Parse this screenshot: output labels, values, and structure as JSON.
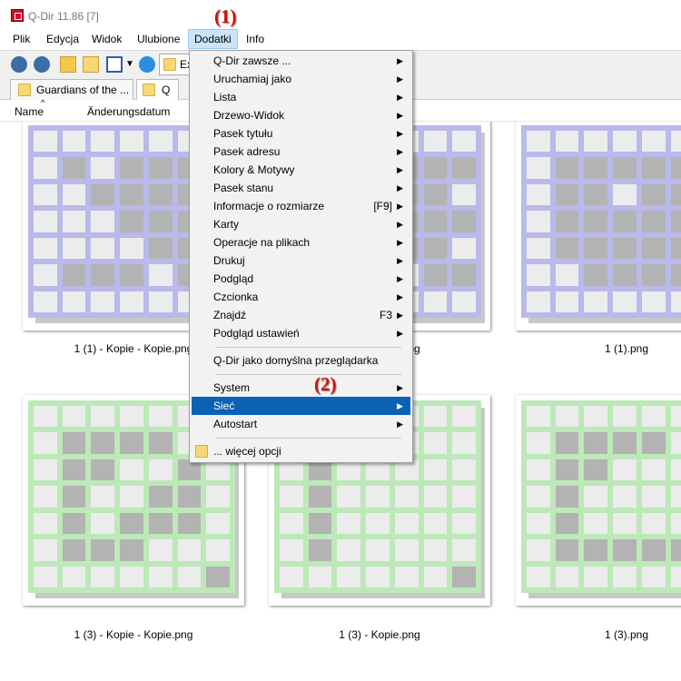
{
  "window": {
    "title": "Q-Dir 11.86 [7]"
  },
  "annotations": {
    "a1": "(1)",
    "a2": "(2)"
  },
  "menubar": {
    "items": [
      "Plik",
      "Edycja",
      "Widok",
      "Ulubione",
      "Dodatki",
      "Info"
    ],
    "active": "Dodatki"
  },
  "toolbar": {
    "address_text": "Ex"
  },
  "tabs": [
    {
      "label": "Guardians of the ..."
    },
    {
      "label": "Q"
    }
  ],
  "columns": {
    "name": "Name",
    "date": "Änderungsdatum"
  },
  "files": {
    "row1": [
      "1 (1) - Kopie - Kopie.png",
      "1 (1) - Kopie.png",
      "1 (1).png"
    ],
    "row2": [
      "1 (3) - Kopie - Kopie.png",
      "1 (3) - Kopie.png",
      "1 (3).png"
    ]
  },
  "dropdown": {
    "items": [
      {
        "label": "Q-Dir zawsze ...",
        "submenu": true
      },
      {
        "label": "Uruchamiaj jako",
        "submenu": true
      },
      {
        "label": "Lista",
        "submenu": true
      },
      {
        "label": "Drzewo-Widok",
        "submenu": true
      },
      {
        "label": "Pasek tytułu",
        "submenu": true
      },
      {
        "label": "Pasek adresu",
        "submenu": true
      },
      {
        "label": "Kolory & Motywy",
        "submenu": true
      },
      {
        "label": "Pasek stanu",
        "submenu": true
      },
      {
        "label": "Informacje o rozmiarze",
        "shortcut": "[F9]",
        "submenu": true
      },
      {
        "label": "Karty",
        "submenu": true
      },
      {
        "label": "Operacje na plikach",
        "submenu": true
      },
      {
        "label": "Drukuj",
        "submenu": true
      },
      {
        "label": "Podgląd",
        "submenu": true
      },
      {
        "label": "Czcionka",
        "submenu": true
      },
      {
        "label": "Znajdź",
        "shortcut": "F3",
        "submenu": true
      },
      {
        "label": "Podgląd ustawień",
        "submenu": true
      },
      {
        "label": "Q-Dir jako domyślna przeglądarka",
        "submenu": false
      },
      {
        "label": "System",
        "submenu": true
      },
      {
        "label": "Sieć",
        "submenu": true,
        "highlighted": true
      },
      {
        "label": "Autostart",
        "submenu": true
      },
      {
        "label": "... więcej opcji",
        "submenu": false
      }
    ]
  },
  "icons": {
    "back": "back-arrow-icon",
    "forward": "forward-arrow-icon",
    "up": "up-folder-icon",
    "new_folder": "new-folder-icon",
    "view": "view-grid-icon",
    "refresh": "refresh-icon",
    "folder": "folder-icon"
  },
  "colors": {
    "highlight": "#0a62b5",
    "menu_active": "#cce4f7",
    "annotation": "#d01010",
    "purple_board": "#b9b9ea",
    "green_board": "#bde8b8"
  }
}
